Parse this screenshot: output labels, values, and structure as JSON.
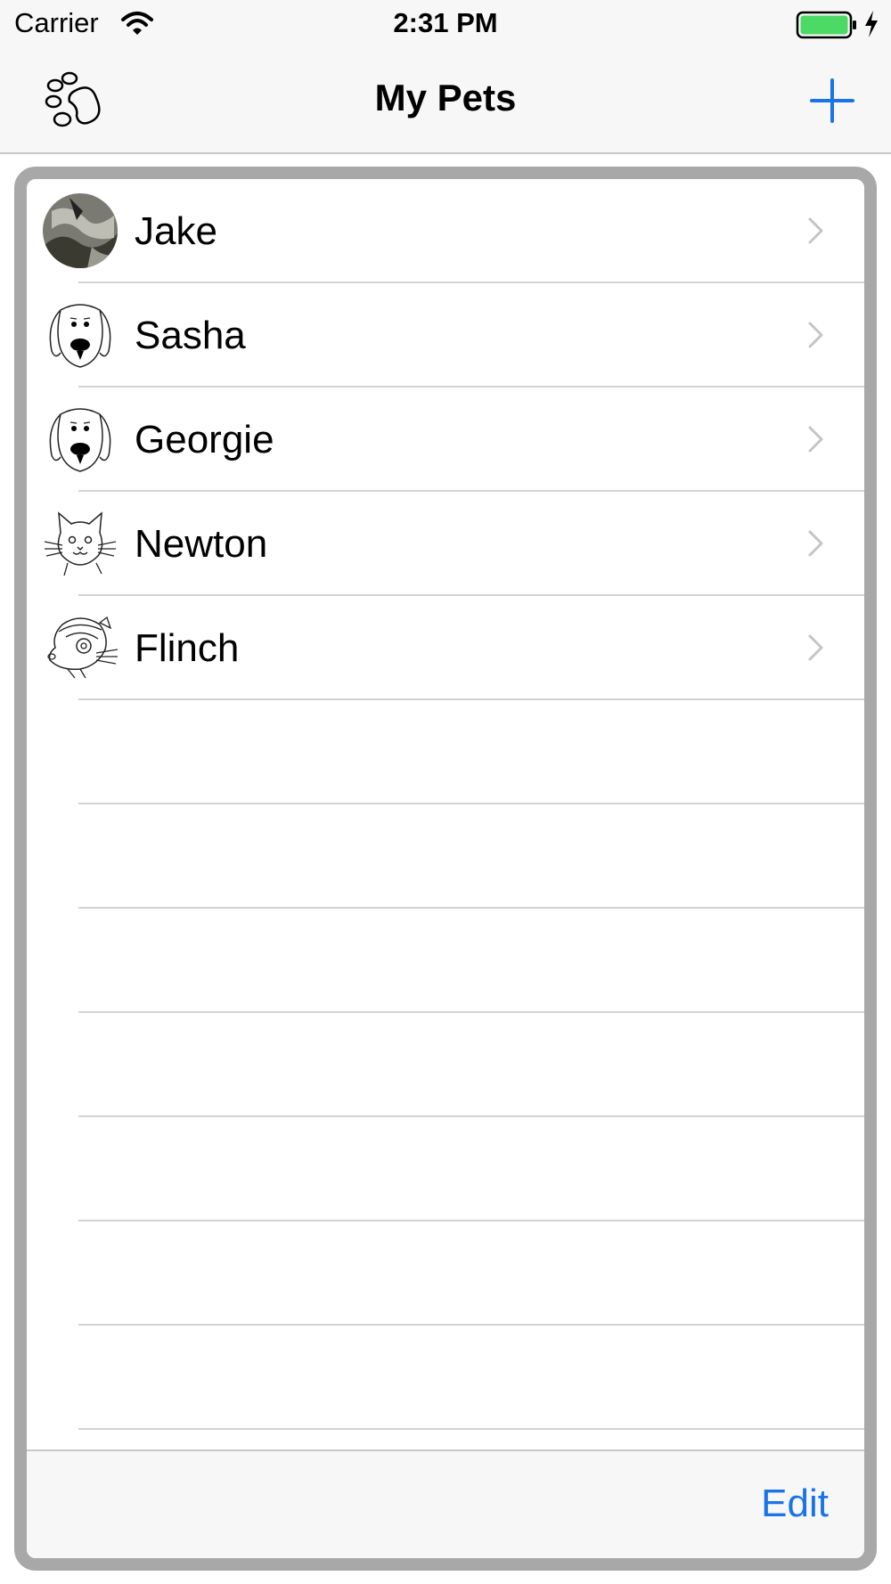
{
  "status_bar": {
    "carrier": "Carrier",
    "time": "2:31 PM"
  },
  "nav": {
    "title": "My Pets",
    "left_icon": "paw-icon",
    "right_icon": "plus-icon"
  },
  "pets": [
    {
      "name": "Jake",
      "avatar": "photo"
    },
    {
      "name": "Sasha",
      "avatar": "dog"
    },
    {
      "name": "Georgie",
      "avatar": "dog"
    },
    {
      "name": "Newton",
      "avatar": "cat"
    },
    {
      "name": "Flinch",
      "avatar": "ferret"
    }
  ],
  "toolbar": {
    "edit_label": "Edit"
  },
  "colors": {
    "accent": "#1a74e8",
    "border": "#a8a8a8",
    "bar": "#f7f7f7",
    "battery": "#4cd964"
  }
}
